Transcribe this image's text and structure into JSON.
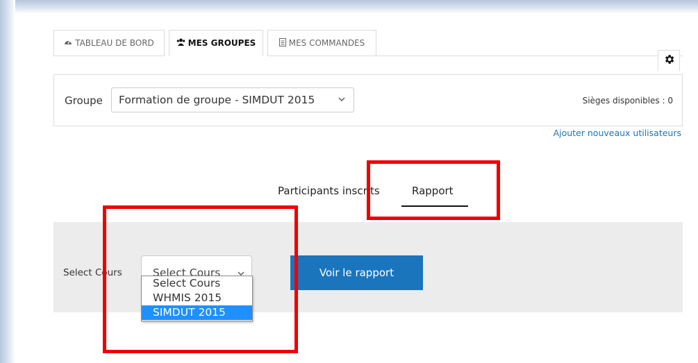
{
  "tabs": [
    {
      "label": "TABLEAU DE BORD",
      "icon": "dashboard-icon",
      "active": false
    },
    {
      "label": "MES GROUPES",
      "icon": "users-icon",
      "active": true
    },
    {
      "label": "MES COMMANDES",
      "icon": "document-icon",
      "active": false
    }
  ],
  "groupe": {
    "label": "Groupe",
    "selected": "Formation de groupe - SIMDUT 2015",
    "sieges": "Sièges disponibles : 0"
  },
  "ajouter_link": "Ajouter nouveaux utilisateurs",
  "report_tabs": [
    {
      "label": "Participants inscrits",
      "active": false
    },
    {
      "label": "Rapport",
      "active": true
    }
  ],
  "filter": {
    "label": "Select Cours",
    "selected": "Select Cours",
    "button": "Voir le rapport",
    "options": [
      "Select Cours",
      "WHMIS 2015",
      "SIMDUT 2015"
    ],
    "highlighted_option": "SIMDUT 2015"
  },
  "colors": {
    "accent": "#1b75bc",
    "highlight_box": "#ee0000",
    "selected_option": "#1e90ff",
    "panel_gray": "#ececec"
  }
}
